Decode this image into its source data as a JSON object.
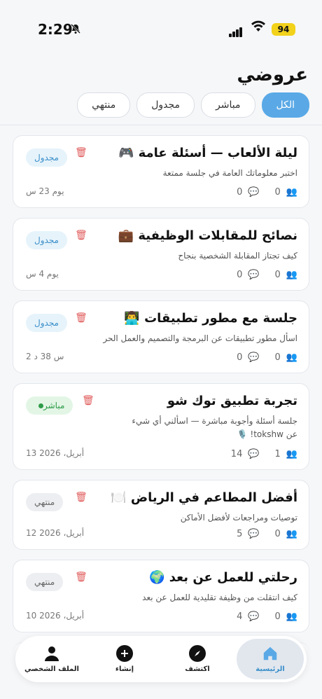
{
  "status": {
    "time": "2:29",
    "battery": "94"
  },
  "page": {
    "title": "عروضي"
  },
  "tabs": [
    "الكل",
    "مباشر",
    "مجدول",
    "منتهي"
  ],
  "cards": [
    {
      "title": "ليلة الألعاب — أسئلة عامة 🎮",
      "desc": "اختبر معلوماتك العامة في جلسة ممتعة",
      "badge": "مجدول",
      "status": "scheduled",
      "date": "يوم 23 س",
      "members": "0",
      "questions": "0"
    },
    {
      "title": "نصائح للمقابلات الوظيفية 💼",
      "desc": "كيف تجتاز المقابلة الشخصية بنجاح",
      "badge": "مجدول",
      "status": "scheduled",
      "date": "يوم 4 س",
      "members": "0",
      "questions": "0"
    },
    {
      "title": "جلسة مع مطور تطبيقات 👨‍💻",
      "desc": "اسأل مطور تطبيقات عن البرمجة والتصميم والعمل الحر",
      "badge": "مجدول",
      "status": "scheduled",
      "date": "2 س 38 د",
      "members": "0",
      "questions": "0"
    },
    {
      "title": "تجربة تطبيق توك شو",
      "desc": "جلسة أسئلة وأجوبة مباشرة — اسألني أي شيء عن tokshw! 🎙️",
      "badge": "مباشر",
      "status": "live",
      "date": "13 أبريل، 2026",
      "members": "1",
      "questions": "14"
    },
    {
      "title": "أفضل المطاعم في الرياض 🍽️",
      "desc": "توصيات ومراجعات لأفضل الأماكن",
      "badge": "منتهي",
      "status": "ended",
      "date": "12 أبريل، 2026",
      "members": "0",
      "questions": "5"
    },
    {
      "title": "رحلتي للعمل عن بعد 🌍",
      "desc": "كيف انتقلت من وظيفة تقليدية للعمل عن بعد",
      "badge": "منتهي",
      "status": "ended",
      "date": "10 أبريل، 2026",
      "members": "0",
      "questions": "4"
    }
  ],
  "nav": [
    {
      "label": "الرئيسية",
      "icon": "home-icon"
    },
    {
      "label": "اكتشف",
      "icon": "compass-icon"
    },
    {
      "label": "إنشاء",
      "icon": "plus-icon"
    },
    {
      "label": "الملف الشخصي",
      "icon": "person-icon"
    }
  ]
}
